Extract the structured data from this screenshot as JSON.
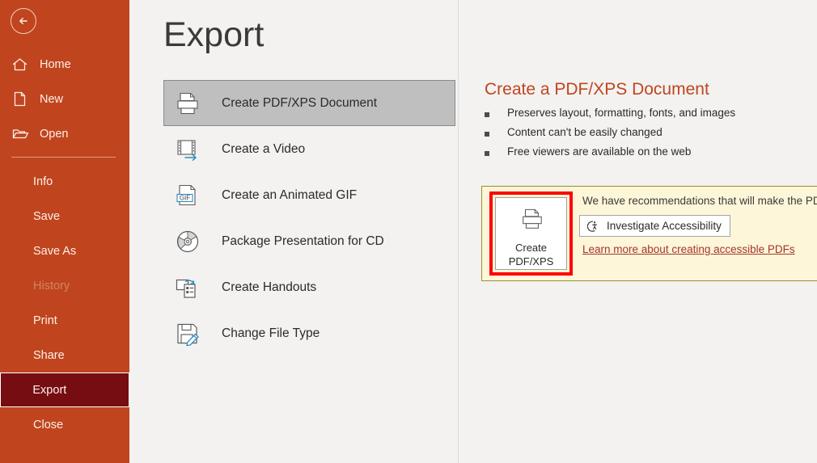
{
  "theme": {
    "sidebar_bg": "#c0451e",
    "sidebar_active_bg": "#760d12",
    "accent": "#c0451e",
    "content_bg": "#f3f2f1",
    "selected_item_bg": "#bfbfbf",
    "notify_bg": "#fdf6d9",
    "notify_border": "#a08c2c",
    "highlight_border": "#ff0000",
    "link_color": "#a4352a"
  },
  "sidebar": {
    "back_button": {
      "icon": "back-arrow-circle-icon",
      "label": "Back"
    },
    "primary_items": [
      {
        "label": "Home",
        "icon": "home-icon"
      },
      {
        "label": "New",
        "icon": "new-document-icon"
      },
      {
        "label": "Open",
        "icon": "open-folder-icon"
      }
    ],
    "secondary_items": [
      {
        "label": "Info",
        "state": "normal"
      },
      {
        "label": "Save",
        "state": "normal"
      },
      {
        "label": "Save As",
        "state": "normal"
      },
      {
        "label": "History",
        "state": "disabled"
      },
      {
        "label": "Print",
        "state": "normal"
      },
      {
        "label": "Share",
        "state": "normal"
      },
      {
        "label": "Export",
        "state": "active"
      },
      {
        "label": "Close",
        "state": "normal"
      }
    ]
  },
  "main": {
    "title": "Export",
    "export_options": [
      {
        "label": "Create PDF/XPS Document",
        "icon": "pdf-printer-icon",
        "selected": true
      },
      {
        "label": "Create a Video",
        "icon": "filmstrip-icon",
        "selected": false
      },
      {
        "label": "Create an Animated GIF",
        "icon": "gif-document-icon",
        "selected": false
      },
      {
        "label": "Package Presentation for CD",
        "icon": "cd-disc-icon",
        "selected": false
      },
      {
        "label": "Create Handouts",
        "icon": "handouts-icon",
        "selected": false
      },
      {
        "label": "Change File Type",
        "icon": "save-pencil-icon",
        "selected": false
      }
    ]
  },
  "detail": {
    "title": "Create a PDF/XPS Document",
    "bullets": [
      "Preserves layout, formatting, fonts, and images",
      "Content can't be easily changed",
      "Free viewers are available on the web"
    ],
    "notification": {
      "message": "We have recommendations that will make the PD",
      "accessibility_button": {
        "label": "Investigate Accessibility",
        "icon": "check-accessibility-icon"
      },
      "learn_more_link": "Learn more about creating accessible PDFs",
      "cta": {
        "icon": "pdf-printer-icon",
        "line1": "Create",
        "line2": "PDF/XPS"
      }
    }
  }
}
